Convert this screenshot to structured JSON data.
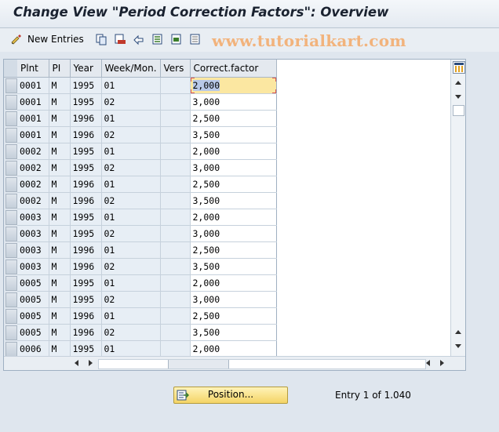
{
  "window": {
    "title": "Change View \"Period Correction Factors\": Overview"
  },
  "watermark": "www.tutorialkart.com",
  "toolbar": {
    "new_entries_label": "New Entries",
    "icons": [
      "glasses-pencil-icon",
      "copy-icon",
      "delete-icon",
      "undo-icon",
      "select-all-icon",
      "select-block-icon",
      "deselect-all-icon"
    ]
  },
  "table": {
    "columns": [
      "Plnt",
      "PI",
      "Year",
      "Week/Mon.",
      "Vers",
      "Correct.factor"
    ],
    "rows": [
      [
        "0001",
        "M",
        "1995",
        "01",
        "",
        "2,000"
      ],
      [
        "0001",
        "M",
        "1995",
        "02",
        "",
        "3,000"
      ],
      [
        "0001",
        "M",
        "1996",
        "01",
        "",
        "2,500"
      ],
      [
        "0001",
        "M",
        "1996",
        "02",
        "",
        "3,500"
      ],
      [
        "0002",
        "M",
        "1995",
        "01",
        "",
        "2,000"
      ],
      [
        "0002",
        "M",
        "1995",
        "02",
        "",
        "3,000"
      ],
      [
        "0002",
        "M",
        "1996",
        "01",
        "",
        "2,500"
      ],
      [
        "0002",
        "M",
        "1996",
        "02",
        "",
        "3,500"
      ],
      [
        "0003",
        "M",
        "1995",
        "01",
        "",
        "2,000"
      ],
      [
        "0003",
        "M",
        "1995",
        "02",
        "",
        "3,000"
      ],
      [
        "0003",
        "M",
        "1996",
        "01",
        "",
        "2,500"
      ],
      [
        "0003",
        "M",
        "1996",
        "02",
        "",
        "3,500"
      ],
      [
        "0005",
        "M",
        "1995",
        "01",
        "",
        "2,000"
      ],
      [
        "0005",
        "M",
        "1995",
        "02",
        "",
        "3,000"
      ],
      [
        "0005",
        "M",
        "1996",
        "01",
        "",
        "2,500"
      ],
      [
        "0005",
        "M",
        "1996",
        "02",
        "",
        "3,500"
      ],
      [
        "0006",
        "M",
        "1995",
        "01",
        "",
        "2,000"
      ]
    ]
  },
  "footer": {
    "position_label": "Position...",
    "entry_text": "Entry 1 of 1.040"
  },
  "colors": {
    "accent": "#f4d466",
    "header_bg": "#e4e9ef",
    "focus": "#fbe7a1"
  }
}
